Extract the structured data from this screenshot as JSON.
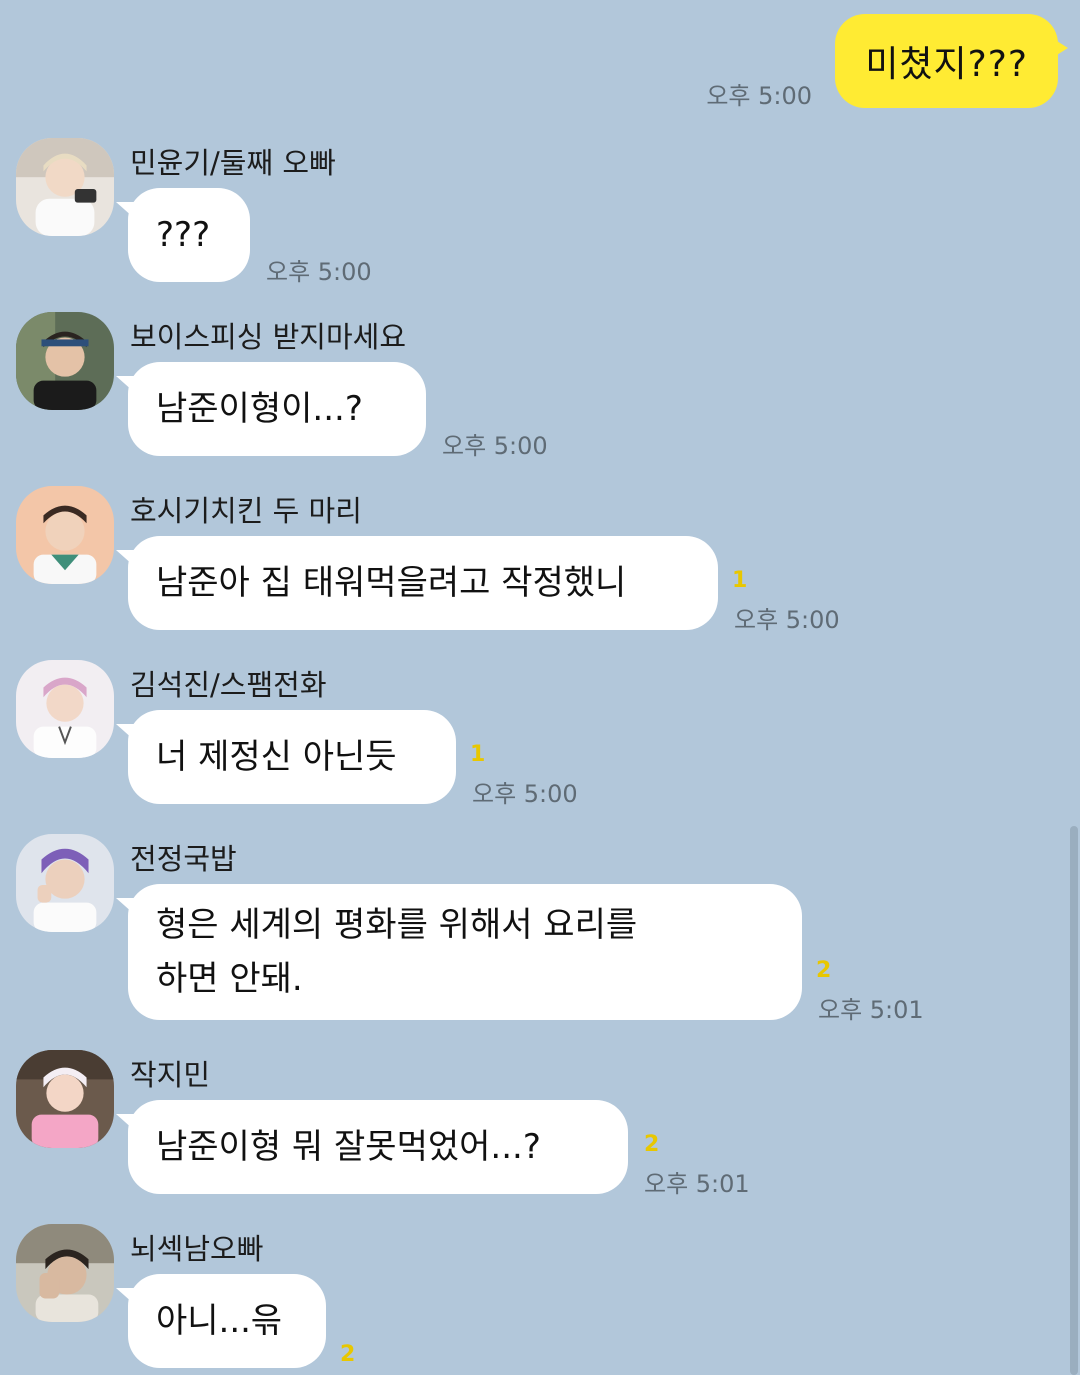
{
  "outgoing": {
    "text": "미쳤지???",
    "time": "오후 5:00"
  },
  "messages": [
    {
      "name": "민윤기/둘째 오빠",
      "text": "???",
      "unread": "",
      "time": "오후 5:00"
    },
    {
      "name": "보이스피싱 받지마세요",
      "text": "남준이형이...?",
      "unread": "",
      "time": "오후 5:00"
    },
    {
      "name": "호시기치킨 두 마리",
      "text": "남준아 집 태워먹을려고 작정했니",
      "unread": "1",
      "time": "오후 5:00"
    },
    {
      "name": "김석진/스팸전화",
      "text": "너 제정신 아닌듯",
      "unread": "1",
      "time": "오후 5:00"
    },
    {
      "name": "전정국밥",
      "text": "형은 세계의 평화를 위해서 요리를\n하면 안돼.",
      "unread": "2",
      "time": "오후 5:01"
    },
    {
      "name": "작지민",
      "text": "남준이형 뭐 잘못먹었어...?",
      "unread": "2",
      "time": "오후 5:01"
    },
    {
      "name": "뇌섹남오빠",
      "text": "아니...윾",
      "unread": "2",
      "time": ""
    }
  ],
  "colors": {
    "background": "#b2c7da",
    "outgoing_bubble": "#ffeb33",
    "incoming_bubble": "#ffffff",
    "unread": "#e8c700"
  }
}
